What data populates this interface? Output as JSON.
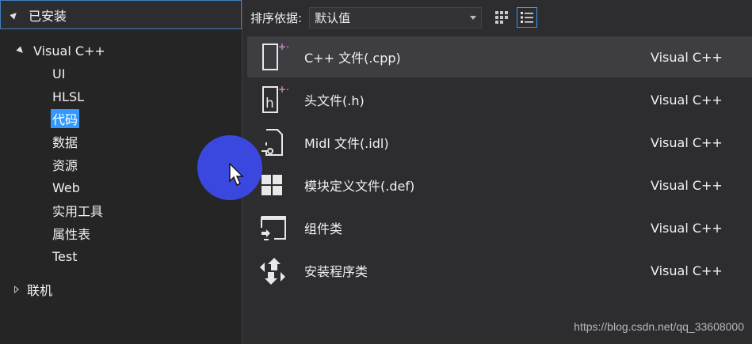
{
  "left_panel": {
    "installed_label": "已安装",
    "tree": [
      {
        "label": "Visual C++",
        "level": 0,
        "expanded": true
      },
      {
        "label": "UI",
        "level": 1
      },
      {
        "label": "HLSL",
        "level": 1
      },
      {
        "label": "代码",
        "level": 1,
        "selected": true
      },
      {
        "label": "数据",
        "level": 1
      },
      {
        "label": "资源",
        "level": 1
      },
      {
        "label": "Web",
        "level": 1
      },
      {
        "label": "实用工具",
        "level": 1
      },
      {
        "label": "属性表",
        "level": 1
      },
      {
        "label": "Test",
        "level": 1
      },
      {
        "label": "联机",
        "level": 0,
        "expanded": false
      }
    ]
  },
  "toolbar": {
    "sort_label": "排序依据:",
    "sort_value": "默认值",
    "grid_view_icon": "grid-view-icon",
    "list_view_icon": "list-view-icon"
  },
  "items": [
    {
      "name": "C++ 文件(.cpp)",
      "lang": "Visual C++",
      "icon": "cpp-file-icon",
      "selected": true
    },
    {
      "name": "头文件(.h)",
      "lang": "Visual C++",
      "icon": "header-file-icon"
    },
    {
      "name": "Midl 文件(.idl)",
      "lang": "Visual C++",
      "icon": "idl-file-icon"
    },
    {
      "name": "模块定义文件(.def)",
      "lang": "Visual C++",
      "icon": "module-definition-icon"
    },
    {
      "name": "组件类",
      "lang": "Visual C++",
      "icon": "component-class-icon"
    },
    {
      "name": "安装程序类",
      "lang": "Visual C++",
      "icon": "installer-class-icon"
    }
  ],
  "watermark": "https://blog.csdn.net/qq_33608000",
  "colors": {
    "background": "#2d2d30",
    "panel": "#252526",
    "selection": "#3399ff",
    "selected_row": "#3e3e42",
    "accent_badge": "#c586c0",
    "cursor_highlight": "#3b48e0"
  }
}
